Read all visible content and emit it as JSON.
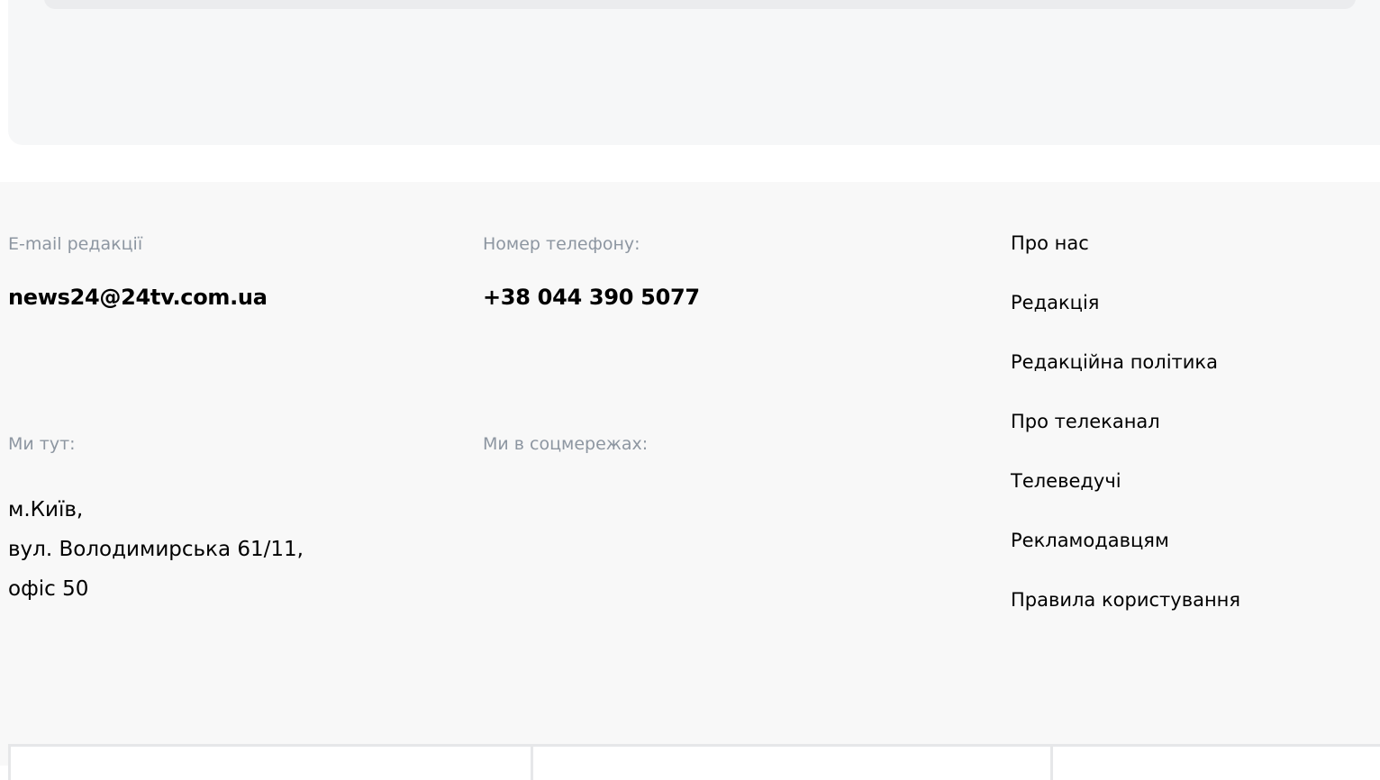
{
  "contacts": {
    "email_label": "E-mail редакції",
    "email_value": "news24@24tv.com.ua",
    "phone_label": "Номер телефону:",
    "phone_value": "+38 044 390 5077",
    "address_label": "Ми тут:",
    "address_lines": [
      "м.Київ,",
      "вул. Володимирська 61/11,",
      "офіс 50"
    ],
    "social_label": "Ми в соцмережах:"
  },
  "nav": {
    "items": [
      {
        "label": "Про нас"
      },
      {
        "label": "Редакція"
      },
      {
        "label": "Редакційна політика"
      },
      {
        "label": "Про телеканал"
      },
      {
        "label": "Телеведучі"
      },
      {
        "label": "Рекламодавцям"
      },
      {
        "label": "Правила користування"
      }
    ]
  },
  "colors": {
    "panel_bg": "#f6f7f8",
    "footer_bg": "#f8f8f8",
    "label_gray": "#8d96a1",
    "card_border": "#e6e7e9"
  }
}
